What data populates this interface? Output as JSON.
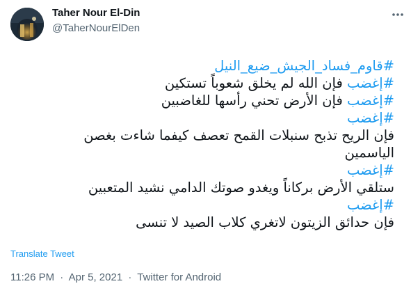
{
  "author": {
    "name": "Taher Nour El-Din",
    "handle": "@TaherNourElDen",
    "avatar_icon": "avatar-photo"
  },
  "tweet": {
    "lines": [
      {
        "hashtag": "#قاوم_فساد_الجيش_ضيع_النيل",
        "text": ""
      },
      {
        "hashtag": "#إغضب",
        "text": " فإن الله لم يخلق شعوباً تستكين"
      },
      {
        "hashtag": "#إغضب",
        "text": " فإن الأرض تحني رأسها للغاضبين"
      },
      {
        "hashtag": "#إغضب",
        "text": ""
      },
      {
        "hashtag": "",
        "text": "فإن الريح تذبح سنبلات القمح تعصف كيفما شاءت بغصن"
      },
      {
        "hashtag": "",
        "text": "الياسمين"
      },
      {
        "hashtag": "#إغضب",
        "text": ""
      },
      {
        "hashtag": "",
        "text": " ستلقي الأرض بركاناً ويغدو صوتك الدامي نشيد المتعبين"
      },
      {
        "hashtag": "#إغضب",
        "text": ""
      },
      {
        "hashtag": "",
        "text": " فإن حدائق الزيتون لاتغري كلاب الصيد لا تنسى"
      }
    ]
  },
  "translate_label": "Translate Tweet",
  "meta": {
    "time": "11:26 PM",
    "separator": "·",
    "date": "Apr 5, 2021",
    "source": "Twitter for Android"
  },
  "colors": {
    "link": "#1d9bf0",
    "secondary_text": "#536471",
    "primary_text": "#0f1419"
  },
  "icons": {
    "more": "more-horizontal-icon"
  }
}
